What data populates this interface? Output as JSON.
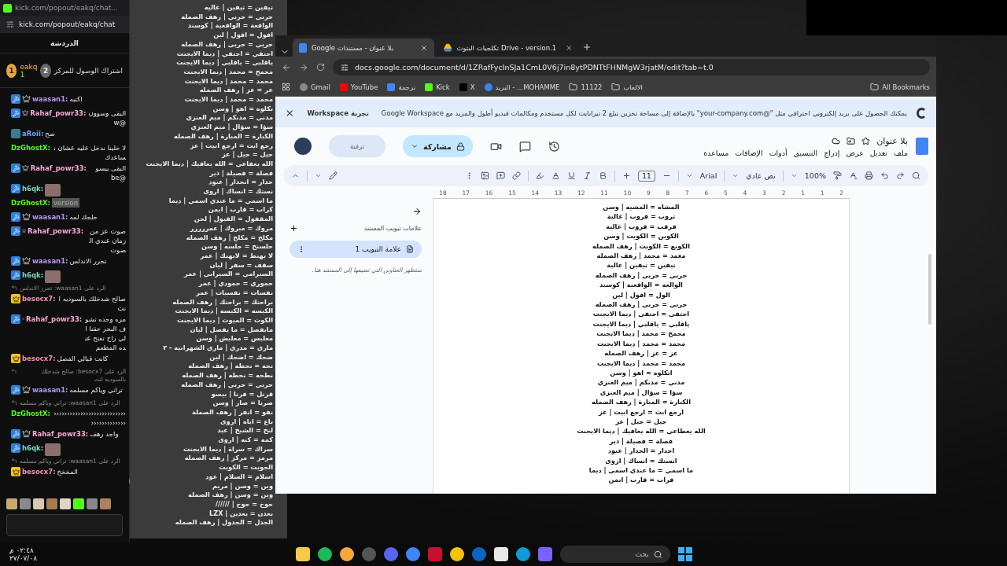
{
  "chat_window": {
    "title": "kick.com/popout/eakq/chat...",
    "url": "kick.com/popout/eakq/chat",
    "header": "الدردشة",
    "pinned": {
      "rank": "1",
      "user": "eakq",
      "count": "1",
      "second_rank": "2",
      "text": "اشتراك الوصول للمركز"
    },
    "messages": [
      {
        "kind": "text",
        "user": "waasan1:",
        "color": "#b794f4",
        "moderator": true,
        "subscriber": true,
        "vip": false,
        "og": false,
        "text": "اكتبه"
      },
      {
        "kind": "text",
        "user": "Rahaf_powr33:",
        "color": "#f9a8d4",
        "moderator": true,
        "subscriber": true,
        "vip": false,
        "og": false,
        "text": "البقى وسوون @w"
      },
      {
        "kind": "text",
        "user": "aRoii:",
        "color": "#60a5fa",
        "moderator": false,
        "subscriber": false,
        "vip": false,
        "og": true,
        "text": "صح"
      },
      {
        "kind": "text",
        "user": "DzGhostX:",
        "color": "#53fc18",
        "moderator": false,
        "subscriber": false,
        "vip": false,
        "og": false,
        "text": "لا خلينا ندخل عليه عشان نساعدك"
      },
      {
        "kind": "text",
        "user": "Rahaf_powr33:",
        "color": "#f9a8d4",
        "moderator": true,
        "subscriber": true,
        "vip": false,
        "og": false,
        "text": "البقى بيسو @be"
      },
      {
        "kind": "image",
        "user": "h6qk:",
        "color": "#7dd3c0",
        "moderator": true,
        "subscriber": false,
        "vip": false,
        "og": false
      },
      {
        "kind": "code",
        "user": "DzGhostX:",
        "color": "#53fc18",
        "moderator": false,
        "subscriber": false,
        "vip": false,
        "og": false,
        "text": "version"
      },
      {
        "kind": "text",
        "user": "waasan1:",
        "color": "#b794f4",
        "moderator": true,
        "subscriber": true,
        "vip": false,
        "og": false,
        "text": "حلجك لمه"
      },
      {
        "kind": "text",
        "user": "Rahaf_powr33:",
        "color": "#f9a8d4",
        "moderator": true,
        "subscriber": true,
        "vip": false,
        "og": false,
        "text": "صوت عز من زمان عندي الصوت"
      },
      {
        "kind": "text",
        "user": "waasan1:",
        "color": "#b794f4",
        "moderator": true,
        "subscriber": true,
        "vip": false,
        "og": false,
        "text": "تحرر الاندلس"
      },
      {
        "kind": "image",
        "user": "h6qk:",
        "color": "#7dd3c0",
        "moderator": true,
        "subscriber": false,
        "vip": false,
        "og": false
      },
      {
        "kind": "reply",
        "text": "الرد على waasan1: تحرر الاندلس"
      },
      {
        "kind": "text",
        "user": "besocx7:",
        "color": "#f48fb1",
        "moderator": false,
        "subscriber": false,
        "vip": true,
        "og": false,
        "text": "صالح شدخلك بالسوديه انت"
      },
      {
        "kind": "text",
        "user": "Rahaf_powr33:",
        "color": "#f9a8d4",
        "moderator": true,
        "subscriber": true,
        "vip": false,
        "og": false,
        "text": "مره وحده تشوف البحر حقنا الي راح تفتح عنده المطعم"
      },
      {
        "kind": "text",
        "user": "besocx7:",
        "color": "#f48fb1",
        "moderator": false,
        "subscriber": false,
        "vip": true,
        "og": false,
        "text": "كانت قبالي الفصل"
      },
      {
        "kind": "reply",
        "text": "الرد على besocx7: صالح شدخلك بالسوديه انت"
      },
      {
        "kind": "text",
        "user": "waasan1:",
        "color": "#b794f4",
        "moderator": true,
        "subscriber": true,
        "vip": false,
        "og": false,
        "text": "تراني وياكم مسلمه"
      },
      {
        "kind": "reply",
        "text": "الرد على waasan1: تراني وياكم مسلمه"
      },
      {
        "kind": "text",
        "user": "DzGhostX:",
        "color": "#53fc18",
        "moderator": false,
        "subscriber": false,
        "vip": false,
        "og": false,
        "text": "‹‹‹‹‹‹‹‹‹‹‹‹‹‹‹‹‹‹‹‹‹‹‹‹‹‹‹‹‹‹‹‹‹‹‹‹‹‹‹‹"
      },
      {
        "kind": "text",
        "user": "Rahaf_powr33:",
        "color": "#f9a8d4",
        "moderator": true,
        "subscriber": true,
        "vip": false,
        "og": false,
        "text": "واجد رهف"
      },
      {
        "kind": "image",
        "user": "h6qk:",
        "color": "#7dd3c0",
        "moderator": true,
        "subscriber": false,
        "vip": false,
        "og": false
      },
      {
        "kind": "reply",
        "text": "الرد على waasan1: تراني وياكم مسلمه"
      },
      {
        "kind": "text",
        "user": "besocx7:",
        "color": "#f48fb1",
        "moderator": false,
        "subscriber": false,
        "vip": true,
        "og": false,
        "text": "المخخخ"
      }
    ]
  },
  "text_list": {
    "lines": [
      "تيفين = تيفين | غاليه",
      "حربي = حربي | رهف الصمله",
      "الواقعة = الواقعية | كوسند",
      "افول = افول | لين",
      "حربي = حربي | رهف الصمله",
      "احتفي = احتفي | ديما الايجنت",
      "ياقلبي = ياقلبي | ديما الايجنت",
      "محمح = محمد | ديما الايجنت",
      "محمد = محمد | ديما الايجنت",
      "عر = عز | رهف الصمله",
      "محمد = محمد | ديما الايجنت",
      "تكلوه = اهو | وسن",
      "مدني = مدنكم | ميم العنزي",
      "سؤا = سؤال | ميم العنزي",
      "الكبارة = المبارة | رهف الصمله",
      "رجع ابت = ارجع ابيت | عز",
      "حيل = حيل | عز",
      "الله يعفاعي = الله يعافيك | ديما الايجنت",
      "فصلة = فصيلة | ذير",
      "حدار = انحدار | عبود",
      "نستك = انساك | اروى",
      "ما اسمي = ما عندي اسمي | ديما",
      "كراب = قارب | ايمن",
      "المقفول = القبول | لحن",
      "مروك = مبروك | عمررررر",
      "مكلح = مكلح | رهف الصمله",
      "حلسنح = حلسه | وسن",
      "لا بهبط = لابهبك | عمر",
      "سقف = سفر | ليان",
      "السيرامي = السيرابي | عمر",
      "حموري = حمودي | عمر",
      "نفسات = نفسيات | عمر",
      "براحتك = براحتك | رهف الصمله",
      "الكيسه = الكيسه | ديما الايجنت",
      "الكوت = الميوت | ديما الايجنت",
      "مابفصل = ما يفصل | ليان",
      "معلبس = معلبش | وسن",
      "ماري = مدري | ماري الشهرانيه - ٢",
      "ضحك = اضحك | لين",
      "نحه = نحطه | رهف الصمله",
      "نطحه = نحطه | رهف الصمله",
      "حربي = حربي | رهف الصمله",
      "قرنل = فرنا | بيسو",
      "صرنا = صار | وسن",
      "نفو = انفر | رهف الصملة",
      "باع = اباه | اروى",
      "لنخ = الشيخ | عبد",
      "كمه = كنه | اروى",
      "سراك = سراة | ديما الايجنت",
      "مرمز = مركز | رهف الصمله",
      "الجويت = الكويت",
      "اسلام = السلام | عود",
      "وين = وسن | مريم",
      "وبن = وسن | رهف الصمله",
      "حوخ = حوخ | //////",
      "بعدن = بعدين | LZX",
      "الجدل = الجدول | رهف الصمله"
    ]
  },
  "browser": {
    "tabs": [
      {
        "title": "Drive - version.1 تكلجيات البثوث",
        "kind": "drive",
        "selected": false
      },
      {
        "title": "بلا عنوان - مستندات Google",
        "kind": "docs",
        "selected": true
      }
    ],
    "url": "docs.google.com/document/d/1ZRafFycInSJa1CmL0V6j7in8ytPDNTtFHNMgW3rjatM/edit?tab=t.0",
    "bookmarks": [
      {
        "label": "الالعاب",
        "kind": "folder"
      },
      {
        "label": "11122",
        "kind": "folder"
      },
      {
        "label": "MOHAMME... - البريد",
        "kind": "mail"
      },
      {
        "label": "X",
        "kind": "x"
      },
      {
        "label": "Kick",
        "kind": "kick"
      },
      {
        "label": "ترجمة",
        "kind": "translate"
      },
      {
        "label": "YouTube",
        "kind": "youtube"
      },
      {
        "label": "Gmail",
        "kind": "google"
      }
    ],
    "all_bookmarks": "All Bookmarks"
  },
  "docs": {
    "banner": {
      "text": "يمكنك الحصول على بريد إلكتروني احترافي مثل \"@your-company.com\"  بالإضافة إلى مساحة تخزين تبلغ 2 تيرابايت لكل مستخدم ومكالمات فيديو أطول والمزيد مع Google Workspace",
      "action": "تجربة Workspace"
    },
    "title": "بلا عنوان",
    "menus": [
      "ملف",
      "تعديل",
      "عرض",
      "إدراج",
      "التنسيق",
      "أدوات",
      "الإضافات",
      "مساعدة"
    ],
    "share": "مشاركة",
    "upgrade": "ترقية",
    "toolbar": {
      "zoom": "100%",
      "style": "نص عادي",
      "font": "Arial",
      "font_size": "11"
    },
    "ruler": [
      "2",
      "1",
      "1",
      "2",
      "3",
      "4",
      "5",
      "6",
      "7",
      "8",
      "9",
      "10",
      "11",
      "12",
      "13",
      "14",
      "15",
      "16",
      "17",
      "18"
    ],
    "sidebar": {
      "title": "علامات تبويب المستند",
      "tabs": [
        {
          "label": "علامة التبويب 1",
          "selected": true
        }
      ],
      "hint": "ستظهر العناوين التي تضيفها إلى المستند هنا."
    },
    "lines": [
      "المشاه = المشيه | وسن",
      "تروب = قروب | غالية",
      "قرقب = قروب | غالية",
      "الكوين = الكويت | وسن",
      "الكويع = الكويت | رهف الصمله",
      "مغمد = محمد | رهف الصمله",
      "تيفين = تيفين | غالية",
      "حربي = حربي | رهف الصمله",
      "الوالعة = الواقعية | كوسند",
      "الول = افول | لين",
      "جربي = حربي | رهف الصمله",
      "احتفى = احتفى | ديما الايجنت",
      "ياقلبي = ياقلبي | ديما الايجنت",
      "محمح = محمد | ديما الايجنت",
      "محمد = محمد | ديما الايجنت",
      "عز = عز | رهف الصمله",
      "محمد = محمد | ديما الايجنت",
      "اتكلوه = اهو | وسن",
      "مدني = مدنكم | ميم العنزي",
      "سؤا = سؤال | ميم العنزي",
      "الكبارة = المبارة | رهف الصمله",
      "ارجع ابث = ارجع ابيت | عز",
      "حيل = حيل | عز",
      "الله يعطاعي = الله يعافيك | ديما الايجنت",
      "فصلة = فصيلة | ذير",
      "احدار = الحدار | عبود",
      "انستك = انساك | اروى",
      "ما اسمي = ما عندي اسمي | ديما",
      "قراب = قارب | ايمن"
    ]
  },
  "taskbar": {
    "search_placeholder": "بحث",
    "time": "٠٢:٤٨ م",
    "date": "٢٧/٠٧/٠٨"
  }
}
